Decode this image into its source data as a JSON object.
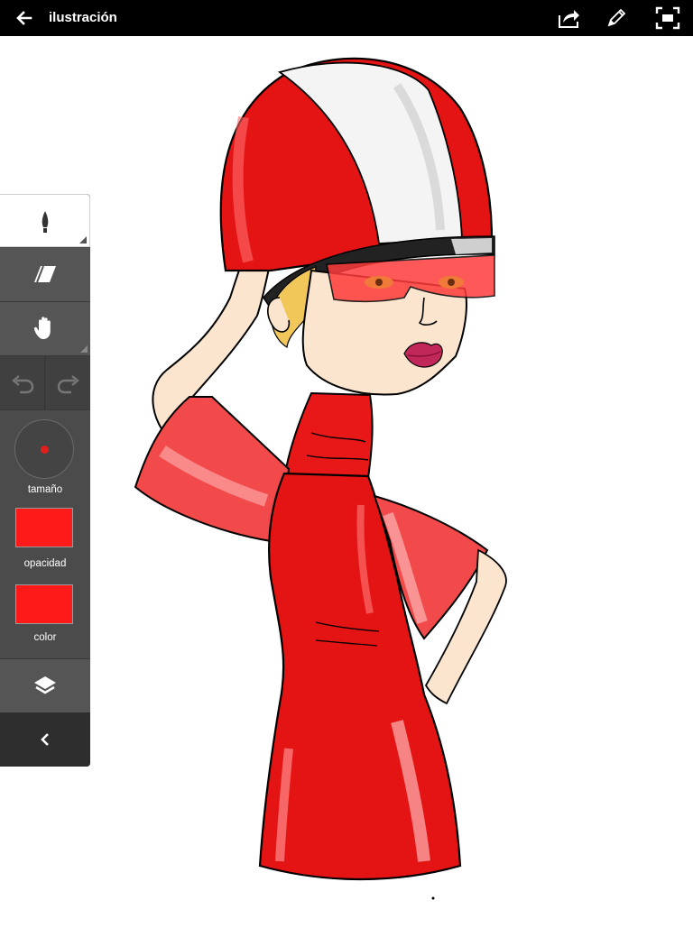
{
  "header": {
    "title": "ilustración"
  },
  "toolbar": {
    "size_label": "tamaño",
    "opacity_label": "opacidad",
    "color_label": "color"
  },
  "colors": {
    "current_color": "#ff1a1a",
    "opacity_swatch": "#ff1a1a",
    "size_dot": "#e21d1d"
  },
  "icons": [
    "back-arrow-icon",
    "share-icon",
    "pencil-icon",
    "fullscreen-icon",
    "brush-icon",
    "eraser-icon",
    "hand-icon",
    "undo-icon",
    "redo-icon",
    "layers-icon",
    "chevron-left-icon"
  ]
}
